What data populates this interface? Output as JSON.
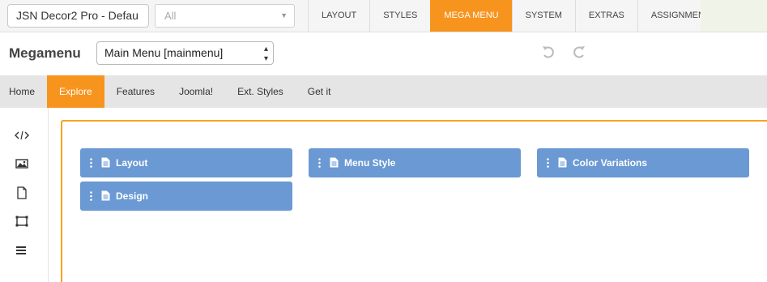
{
  "topbar": {
    "template_name": "JSN Decor2 Pro - Defau",
    "filter_value": "All",
    "tabs": [
      {
        "label": "LAYOUT"
      },
      {
        "label": "STYLES"
      },
      {
        "label": "MEGA MENU"
      },
      {
        "label": "SYSTEM"
      },
      {
        "label": "EXTRAS"
      },
      {
        "label": "ASSIGNMENT"
      }
    ],
    "active_tab": "MEGA MENU"
  },
  "header": {
    "title": "Megamenu",
    "menu_select_value": "Main Menu [mainmenu]"
  },
  "menubar": {
    "items": [
      {
        "label": "Home"
      },
      {
        "label": "Explore"
      },
      {
        "label": "Features"
      },
      {
        "label": "Joomla!"
      },
      {
        "label": "Ext. Styles"
      },
      {
        "label": "Get it"
      }
    ],
    "active_item": "Explore"
  },
  "toolbar": {
    "icons": [
      "code-icon",
      "image-icon",
      "file-icon",
      "frame-icon",
      "menu-icon"
    ]
  },
  "mega": {
    "blocks": [
      {
        "label": "Layout"
      },
      {
        "label": "Menu Style"
      },
      {
        "label": "Color Variations"
      },
      {
        "label": "Design"
      }
    ]
  },
  "colors": {
    "accent": "#f7941d",
    "block_blue": "#6a99d3",
    "panel_border": "#f7a21b"
  }
}
